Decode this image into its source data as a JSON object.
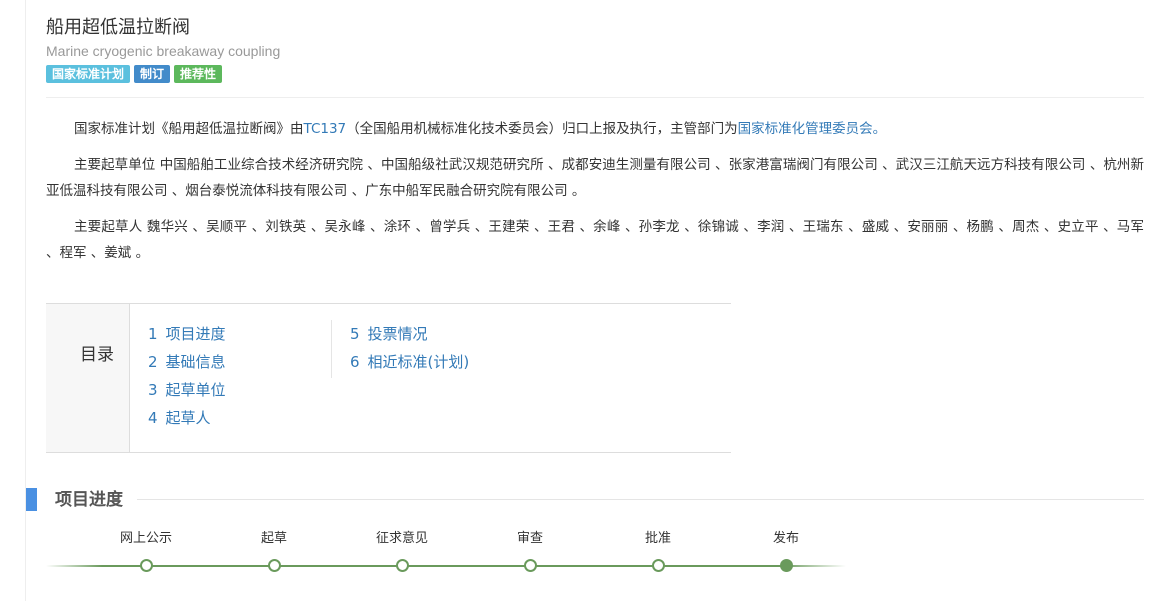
{
  "header": {
    "title_cn": "船用超低温拉断阀",
    "title_en": "Marine cryogenic breakaway coupling",
    "badges": [
      {
        "label": "国家标准计划",
        "color": "#5bc0de"
      },
      {
        "label": "制订",
        "color": "#428bca"
      },
      {
        "label": "推荐性",
        "color": "#5cb85c"
      }
    ]
  },
  "intro": {
    "part1": "国家标准计划《船用超低温拉断阀》由",
    "tc_link": "TC137",
    "part2": "（全国船用机械标准化技术委员会）归口上报及执行，主管部门为",
    "dept_link": "国家标准化管理委员会",
    "part3": "。"
  },
  "drafting_units": {
    "text": "主要起草单位 中国船舶工业综合技术经济研究院 、中国船级社武汉规范研究所 、成都安迪生测量有限公司 、张家港富瑞阀门有限公司 、武汉三江航天远方科技有限公司 、杭州新亚低温科技有限公司 、烟台泰悦流体科技有限公司 、广东中船军民融合研究院有限公司 。"
  },
  "drafters": {
    "text": "主要起草人 魏华兴 、吴顺平 、刘铁英 、吴永峰 、涂环 、曾学兵 、王建荣 、王君 、余峰 、孙李龙 、徐锦诚 、李润 、王瑞东 、盛威 、安丽丽 、杨鹏 、周杰 、史立平 、马军 、程军 、姜斌 。"
  },
  "toc": {
    "label": "目录",
    "column1": [
      {
        "num": "1",
        "label": "项目进度"
      },
      {
        "num": "2",
        "label": "基础信息"
      },
      {
        "num": "3",
        "label": "起草单位"
      },
      {
        "num": "4",
        "label": "起草人"
      }
    ],
    "column2": [
      {
        "num": "5",
        "label": "投票情况"
      },
      {
        "num": "6",
        "label": "相近标准(计划)"
      }
    ]
  },
  "progress": {
    "title": "项目进度",
    "accent_color": "#4a90e2",
    "line_color": "#6a9a5c",
    "current_step": "发布",
    "steps": [
      "网上公示",
      "起草",
      "征求意见",
      "审查",
      "批准",
      "发布"
    ]
  }
}
